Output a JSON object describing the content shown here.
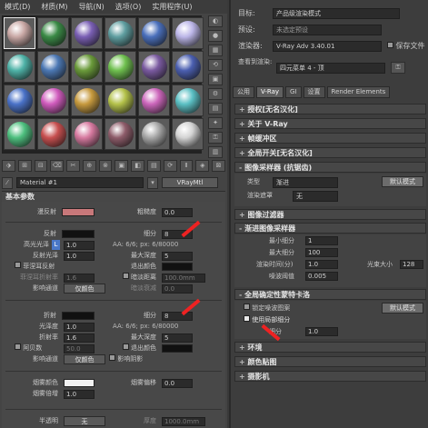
{
  "menu": [
    "模式(D)",
    "材质(M)",
    "导航(N)",
    "选项(O)",
    "实用程序(U)"
  ],
  "sphere_colors": [
    [
      "#c9a8a5",
      "#3a8a46",
      "#7a5fb4",
      "#5f9ea0",
      "#4a6fbb",
      "#bcb6e8"
    ],
    [
      "#4fb3a8",
      "#4c78b4",
      "#6a9a3a",
      "#6fc04f",
      "#7a5aa0",
      "#4b5fb0"
    ],
    [
      "#4a72c8",
      "#d05bbd",
      "#c79a3e",
      "#b4c24a",
      "#cc66bb",
      "#5bc0c4"
    ],
    [
      "#4ec07f",
      "#c74f4f",
      "#d77aa0",
      "#8e5c6a",
      "#a7a7a7",
      "#d4d4d4"
    ]
  ],
  "side_tools": [
    "◐",
    "●",
    "▦",
    "⟲",
    "▣",
    "⚙",
    "▤",
    "✦",
    "⚿",
    "▥"
  ],
  "bottom_tools": [
    "⬗",
    "⊞",
    "⊟",
    "⌫",
    "✂",
    "⊕",
    "⊗",
    "▣",
    "◧",
    "▤",
    "⟳",
    "Ⅱ",
    "◈",
    "⊠"
  ],
  "material_name": "Material #1",
  "material_type": "VRayMtl",
  "basic_params": {
    "title": "基本参数",
    "diffuse_label": "漫反射",
    "roughness_label": "粗糙度",
    "roughness_value": "0.0",
    "reflect_label": "反射",
    "subdivs_label": "细分",
    "subdivs_value": "8",
    "hilight_label": "高光光泽",
    "hilight_l": "L",
    "hilight_value": "1.0",
    "aa_label": "AA: 6/6; px: 6/80000",
    "refl_gloss_label": "反射光泽",
    "refl_gloss_value": "1.0",
    "max_depth_label": "最大深度",
    "max_depth_value": "5",
    "fresnel_label": "菲涅耳反射",
    "exit_color_label": "退出颜色",
    "fresnel_ior_label": "菲涅耳折射率",
    "fresnel_ior_value": "1.6",
    "dim_dist_label": "暗淡距离",
    "dim_dist_value": "100.0mm",
    "affect_ch_label": "影响通道",
    "affect_ch_value": "仅颜色",
    "dim_falloff_label": "暗淡衰减",
    "dim_falloff_value": "0.0",
    "refract_label": "折射",
    "refr_subdivs_value": "8",
    "refr_aa_label": "AA: 6/6; px: 6/80000",
    "gloss_label": "光泽度",
    "gloss_value": "1.0",
    "ior_label": "折射率",
    "ior_value": "1.6",
    "refr_max_depth_value": "5",
    "abbe_label": "阿贝数",
    "abbe_value": "50.0",
    "refr_exit_label": "退出颜色",
    "refr_affect_label": "影响通道",
    "refr_affect_value": "仅颜色",
    "affect_shadows_label": "影响阴影",
    "fog_color_label": "烟雾颜色",
    "fog_bias_label": "烟雾偏移",
    "fog_bias_value": "0.0",
    "fog_mult_label": "烟雾倍增",
    "fog_mult_value": "1.0",
    "translucency_label": "半透明",
    "translucency_value": "无",
    "thickness_label": "厚度",
    "thickness_value": "1000.0mm"
  },
  "right": {
    "target_label": "目标:",
    "target_value": "产品级渲染模式",
    "preset_label": "预设:",
    "preset_value": "未选定预设",
    "renderer_label": "渲染器:",
    "renderer_value": "V-Ray Adv 3.40.01",
    "save_file_label": "保存文件",
    "view_label": "查看到渲染:",
    "view_value": "四元菜单 4 - 顶",
    "tabs": [
      "公用",
      "V-Ray",
      "GI",
      "设置",
      "Render Elements"
    ],
    "rollouts": {
      "auth": "授权[无名汉化]",
      "about": "关于 V-Ray",
      "framebuffer": "帧缓冲区",
      "global_switches": "全局开关[无名汉化]",
      "image_sampler": "图像采样器 (抗锯齿)",
      "image_filter": "图像过滤器",
      "progressive": "渐进图像采样器",
      "global_dmc": "全局确定性蒙特卡洛",
      "environment": "环境",
      "color_mapping": "颜色贴图",
      "camera": "摄影机"
    },
    "sampler_type_label": "类型",
    "sampler_type_value": "渐进",
    "default_mode_label": "默认模式",
    "render_mask_label": "渲染遮罩",
    "render_mask_value": "无",
    "min_subdivs_label": "最小细分",
    "min_subdivs_value": "1",
    "max_subdivs_label": "最大细分",
    "max_subdivs_value": "100",
    "render_time_label": "渲染时间(分)",
    "render_time_value": "1.0",
    "bundle_label": "光束大小",
    "bundle_value": "128",
    "noise_label": "噪波阈值",
    "noise_value": "0.005",
    "lock_noise_label": "锁定噪波图案",
    "dmc_default_label": "默认模式",
    "use_local_subdivs_label": "使用局部细分",
    "dmc_subdivs_label": "细分",
    "dmc_subdivs_value": "1.0"
  }
}
